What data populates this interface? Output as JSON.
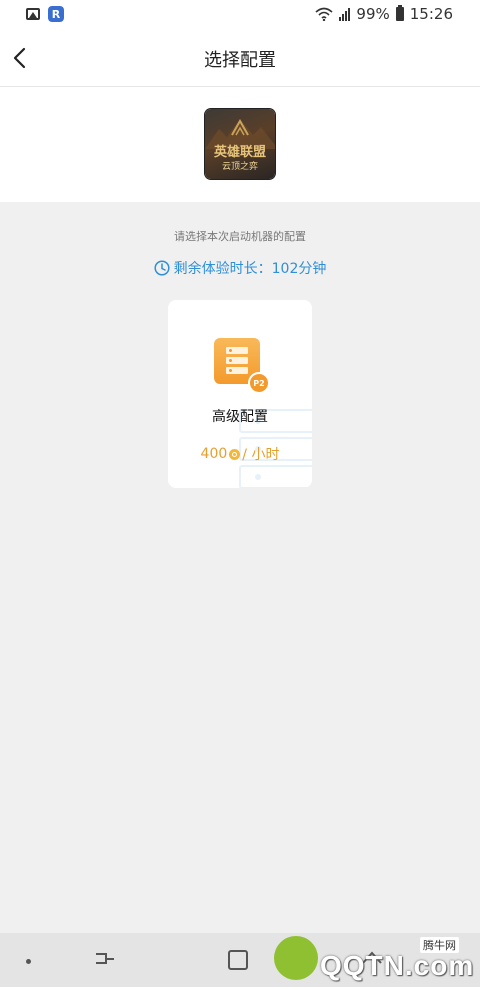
{
  "status_bar": {
    "battery": "99%",
    "time": "15:26",
    "app_badge": "R"
  },
  "header": {
    "title": "选择配置"
  },
  "game": {
    "title": "英雄联盟",
    "subtitle": "云顶之弈"
  },
  "main": {
    "hint": "请选择本次启动机器的配置",
    "remaining_time": "剩余体验时长：102分钟"
  },
  "config_card": {
    "badge": "P2",
    "name": "高级配置",
    "price": "400",
    "unit": "/ 小时"
  },
  "watermark": {
    "domain": "QQTN.com",
    "label": "腾牛网"
  },
  "colors": {
    "accent_blue": "#2f8fd8",
    "price_orange": "#e6a030",
    "icon_orange": "#f39a2c"
  }
}
